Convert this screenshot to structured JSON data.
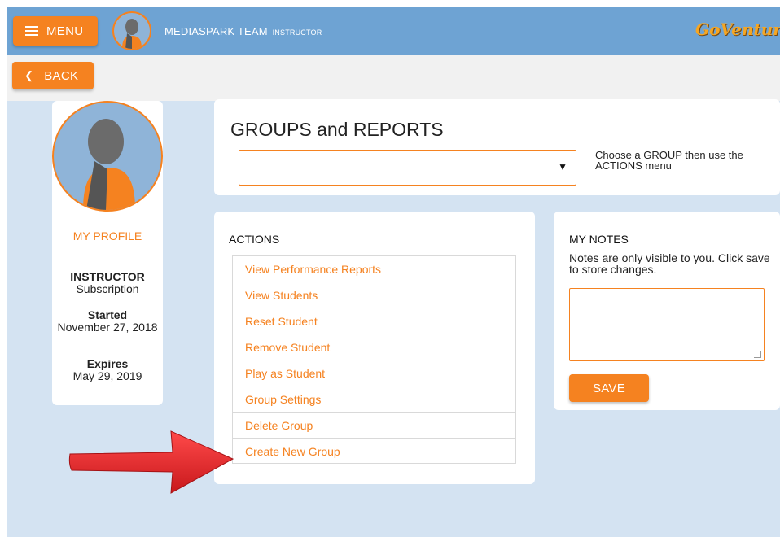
{
  "header": {
    "menu_label": "MENU",
    "user_name": "MEDIASPARK TEAM",
    "user_role": "INSTRUCTOR",
    "logo_text": "GoVenture"
  },
  "subheader": {
    "back_label": "BACK"
  },
  "profile": {
    "link_label": "MY PROFILE",
    "role_title": "INSTRUCTOR",
    "role_sub": "Subscription",
    "started_label": "Started",
    "started_value": "November 27, 2018",
    "expires_label": "Expires",
    "expires_value": "May 29, 2019"
  },
  "groups": {
    "title": "GROUPS and REPORTS",
    "select_value": "",
    "hint": "Choose a GROUP then use the ACTIONS menu"
  },
  "actions": {
    "title": "ACTIONS",
    "items": [
      "View Performance Reports",
      "View Students",
      "Reset Student",
      "Remove Student",
      "Play as Student",
      "Group Settings",
      "Delete Group",
      "Create New Group"
    ]
  },
  "notes": {
    "title": "MY NOTES",
    "description": "Notes are only visible to you. Click save to store changes.",
    "value": "",
    "save_label": "SAVE"
  },
  "colors": {
    "accent": "#f58220",
    "topbar": "#6ea3d3",
    "background": "#d4e3f2",
    "annotation_arrow": "#e8262a"
  },
  "icons": {
    "menu": "hamburger-icon",
    "back": "chevron-left-icon",
    "select": "caret-down-icon",
    "avatar": "person-silhouette-icon",
    "annotation": "red-arrow-icon"
  }
}
